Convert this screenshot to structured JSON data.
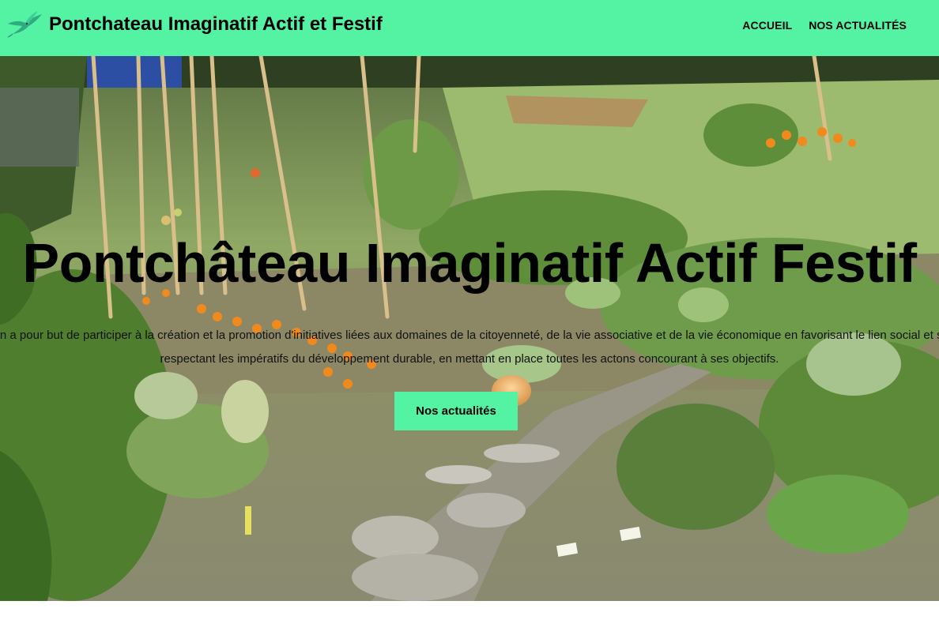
{
  "header": {
    "site_title": "Pontchateau Imaginatif Actif et Festif",
    "logo": "hummingbird-logo",
    "nav": [
      {
        "label": "ACCUEIL"
      },
      {
        "label": "NOS ACTUALITÉS"
      }
    ]
  },
  "hero": {
    "title": "Pontchâteau Imaginatif Actif Festif",
    "text_line1": "L'association a pour but de participer à la création et la promotion d'initiatives liées aux domaines de la citoyenneté, de la vie associative et de la vie économique en favorisant le lien social et solidaire, en",
    "text_line2": "respectant les impératifs du développement durable, en mettant en place toutes les actons concourant à ses objectifs.",
    "cta_label": "Nos actualités"
  },
  "colors": {
    "accent": "#53f3a3"
  }
}
